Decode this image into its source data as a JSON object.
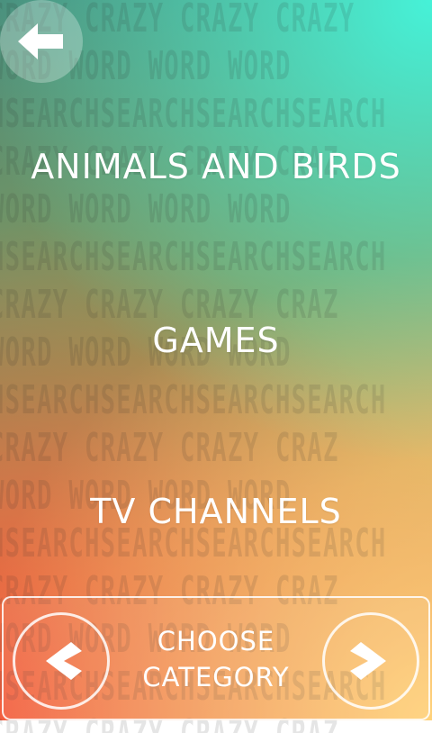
{
  "background": {
    "pattern_lines": [
      "CRAZY  CRAZY  CRAZY CRAZY",
      "  WORD   WORD   WORD WORD",
      "HSEARCHSEARCHSEARCHSEARCH",
      " CRAZY  CRAZY  CRAZY CRAZ",
      "  WORD   WORD   WORD WORD",
      "HSEARCHSEARCHSEARCHSEARCH",
      " CRAZY  CRAZY  CRAZY CRAZ",
      "  WORD   WORD   WORD WORD",
      "HSEARCHSEARCHSEARCHSEARCH",
      " CRAZY  CRAZY  CRAZY CRAZ",
      "  WORD   WORD   WORD WORD",
      "HSEARCHSEARCHSEARCHSEARCH",
      " CRAZY  CRAZY  CRAZY CRAZ",
      "  WORD   WORD   WORD WORD",
      "HSEARCHSEARCHSEARCHSEARCH",
      " CRAZY  CRAZY  CRAZY CRAZ"
    ],
    "colors": {
      "top_right": "#46f2d8",
      "bottom_left": "#f2553a",
      "bottom_right": "#ffd27a"
    }
  },
  "back_button": {
    "icon": "arrow-left-icon"
  },
  "categories": [
    {
      "label": "ANIMALS AND BIRDS"
    },
    {
      "label": "GAMES"
    },
    {
      "label": "TV CHANNELS"
    }
  ],
  "footer": {
    "label_line1": "CHOOSE",
    "label_line2": "CATEGORY",
    "prev_icon": "chevron-left-icon",
    "next_icon": "chevron-right-icon"
  }
}
